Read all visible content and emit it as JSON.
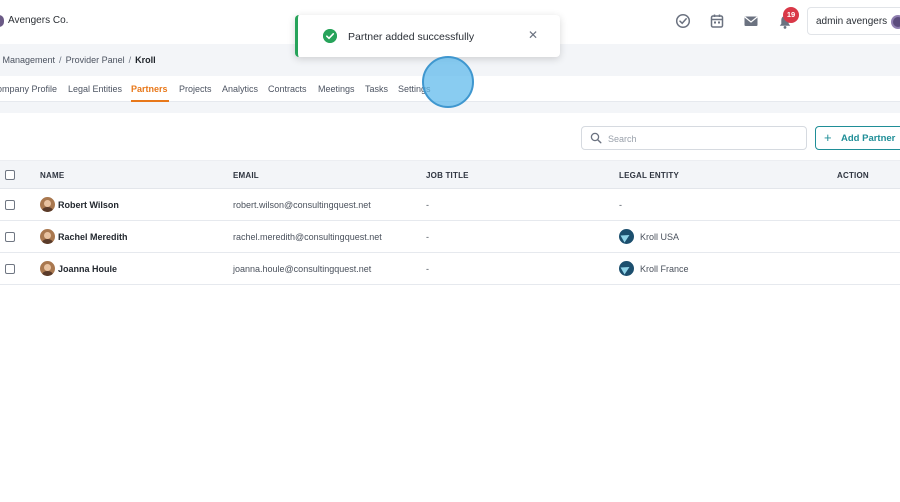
{
  "header": {
    "company": "Avengers Co.",
    "notification_count": "19",
    "user_name": "admin avengers",
    "icons": [
      "check-circle-icon",
      "calendar-icon",
      "mail-icon",
      "bell-icon"
    ]
  },
  "breadcrumb": {
    "items": [
      "l Management",
      "Provider Panel"
    ],
    "separator": "/",
    "current": "Kroll"
  },
  "tabs": [
    {
      "label": "ompany Profile"
    },
    {
      "label": "Legal Entities"
    },
    {
      "label": "Partners",
      "active": true
    },
    {
      "label": "Projects"
    },
    {
      "label": "Analytics"
    },
    {
      "label": "Contracts"
    },
    {
      "label": "Meetings"
    },
    {
      "label": "Tasks"
    },
    {
      "label": "Settings"
    }
  ],
  "toolbar": {
    "search_placeholder": "Search",
    "add_label": "Add Partner",
    "add_plus": "+"
  },
  "table": {
    "columns": [
      "NAME",
      "EMAIL",
      "JOB TITLE",
      "LEGAL ENTITY",
      "ACTION"
    ],
    "rows": [
      {
        "name": "Robert Wilson",
        "email": "robert.wilson@consultingquest.net",
        "job_title": "-",
        "legal_entity": "-"
      },
      {
        "name": "Rachel Meredith",
        "email": "rachel.meredith@consultingquest.net",
        "job_title": "-",
        "legal_entity": "Kroll USA"
      },
      {
        "name": "Joanna Houle",
        "email": "joanna.houle@consultingquest.net",
        "job_title": "-",
        "legal_entity": "Kroll France"
      }
    ]
  },
  "toast": {
    "message": "Partner added successfully",
    "status": "success",
    "close": "✕"
  },
  "colors": {
    "accent_tab": "#e8781a",
    "primary_button": "#1f8e97",
    "success": "#27a35a",
    "badge": "#d93848",
    "entity_logo": "#1c4f6e"
  }
}
